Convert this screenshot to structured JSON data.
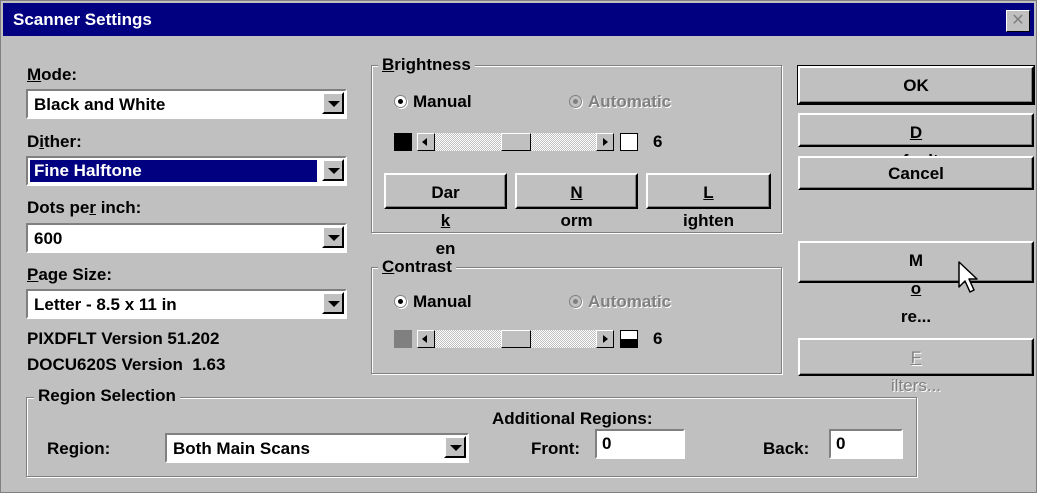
{
  "window": {
    "title": "Scanner Settings",
    "close_glyph": "✕"
  },
  "left": {
    "mode_label_u": "M",
    "mode_label_rest": "ode:",
    "mode_value": "Black and White",
    "dither_label_pre": "D",
    "dither_label_u": "i",
    "dither_label_rest": "ther:",
    "dither_value": "Fine Halftone",
    "dpi_label_pre": "Dots pe",
    "dpi_label_u": "r",
    "dpi_label_rest": " inch:",
    "dpi_value": "600",
    "page_label_u": "P",
    "page_label_rest": "age Size:",
    "page_value": "Letter - 8.5 x 11 in",
    "version1": "PIXDFLT Version 51.202",
    "version2": "DOCU620S Version  1.63"
  },
  "brightness": {
    "title_u": "B",
    "title_rest": "rightness",
    "manual": "Manual",
    "automatic": "Automatic",
    "value": "6",
    "slider_position": 0.45,
    "darken_pre": "Dar",
    "darken_u": "k",
    "darken_rest": "en",
    "norm_u": "N",
    "norm_rest": "orm",
    "lighten_u": "L",
    "lighten_rest": "ighten"
  },
  "contrast": {
    "title_u": "C",
    "title_rest": "ontrast",
    "manual": "Manual",
    "automatic": "Automatic",
    "value": "6",
    "slider_position": 0.45
  },
  "buttons": {
    "ok": "OK",
    "default_u": "D",
    "default_rest": "efault",
    "cancel": "Cancel",
    "more_pre": "M",
    "more_u": "o",
    "more_rest": "re...",
    "filters_u": "F",
    "filters_rest": "ilters..."
  },
  "region": {
    "title": "Region Selection",
    "label_pre": "Re",
    "label_u": "g",
    "label_rest": "ion:",
    "value": "Both Main Scans",
    "additional": "Additional Regions:",
    "front_label": "Front:",
    "front_value": "0",
    "back_label": "Back:",
    "back_value": "0"
  },
  "colors": {
    "titlebar": "#000080",
    "face": "#c0c0c0",
    "selection": "#000080"
  }
}
